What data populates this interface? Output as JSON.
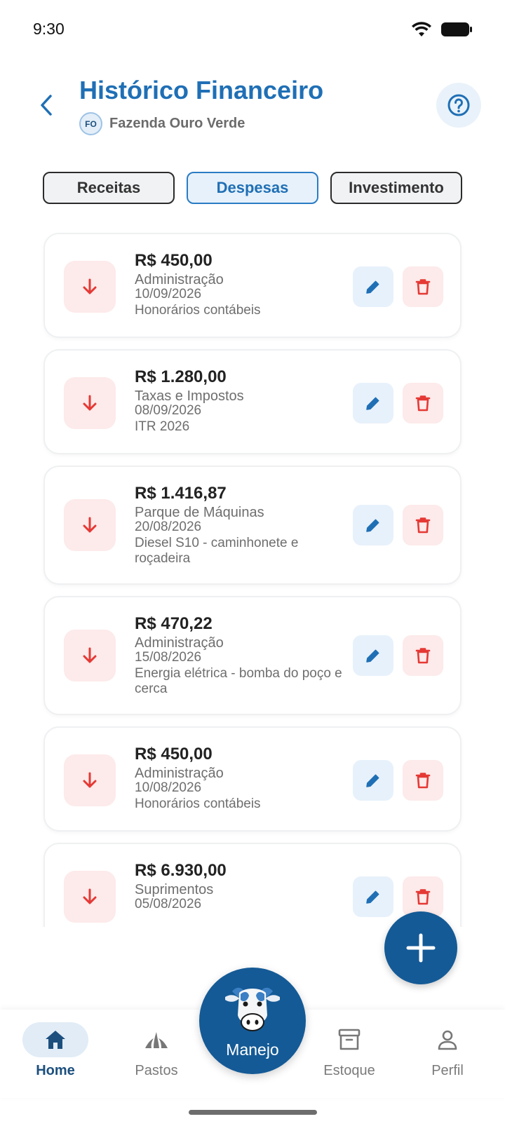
{
  "status_bar": {
    "time": "9:30"
  },
  "header": {
    "title": "Histórico Financeiro",
    "farm_initials": "FO",
    "farm_name": "Fazenda Ouro Verde"
  },
  "tabs": [
    {
      "label": "Receitas",
      "active": false
    },
    {
      "label": "Despesas",
      "active": true
    },
    {
      "label": "Investimento",
      "active": false
    }
  ],
  "expenses": [
    {
      "amount": "R$ 450,00",
      "category": "Administração",
      "date": "10/09/2026",
      "description": "Honorários contábeis"
    },
    {
      "amount": "R$ 1.280,00",
      "category": "Taxas e Impostos",
      "date": "08/09/2026",
      "description": "ITR 2026"
    },
    {
      "amount": "R$ 1.416,87",
      "category": "Parque de Máquinas",
      "date": "20/08/2026",
      "description": "Diesel S10 - caminhonete e roçadeira"
    },
    {
      "amount": "R$ 470,22",
      "category": "Administração",
      "date": "15/08/2026",
      "description": "Energia elétrica - bomba do poço e cerca"
    },
    {
      "amount": "R$ 450,00",
      "category": "Administração",
      "date": "10/08/2026",
      "description": "Honorários contábeis"
    },
    {
      "amount": "R$ 6.930,00",
      "category": "Suprimentos",
      "date": "05/08/2026",
      "description": ""
    }
  ],
  "bottom_nav": {
    "home": "Home",
    "pastos": "Pastos",
    "manejo": "Manejo",
    "estoque": "Estoque",
    "perfil": "Perfil"
  },
  "colors": {
    "primary": "#1f6fb5",
    "dark_blue": "#145a96",
    "expense_red": "#e53935",
    "expense_bg": "#fdeaea",
    "edit_bg": "#e7f1fb"
  },
  "icons": {
    "expense": "arrow-down-icon",
    "edit": "pencil-icon",
    "delete": "trash-icon",
    "help": "question-circle-icon",
    "back": "chevron-left-icon",
    "add": "plus-icon"
  }
}
